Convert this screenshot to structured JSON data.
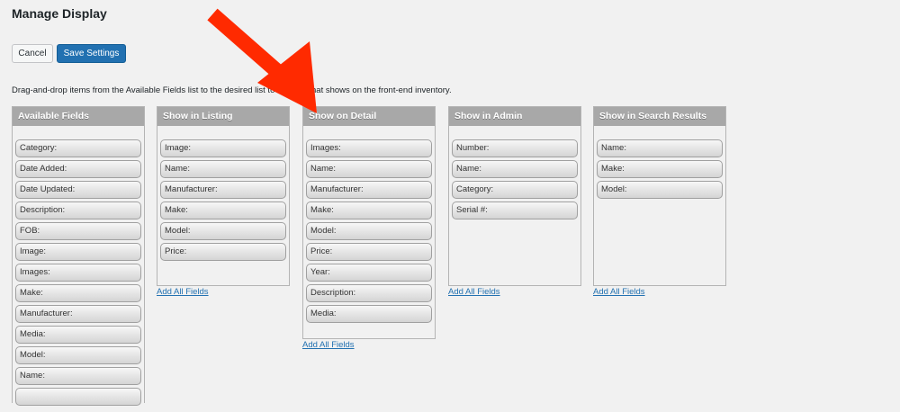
{
  "page": {
    "title": "Manage Display",
    "cancel_label": "Cancel",
    "save_label": "Save Settings",
    "instructions": "Drag-and-drop items from the Available Fields list to the desired list to control what shows on the front-end inventory."
  },
  "columns": [
    {
      "heading": "Available Fields",
      "items": [
        "Category:",
        "Date Added:",
        "Date Updated:",
        "Description:",
        "FOB:",
        "Image:",
        "Images:",
        "Make:",
        "Manufacturer:",
        "Media:",
        "Model:",
        "Name:"
      ]
    },
    {
      "heading": "Show in Listing",
      "items": [
        "Image:",
        "Name:",
        "Manufacturer:",
        "Make:",
        "Model:",
        "Price:"
      ],
      "add_all": "Add All Fields"
    },
    {
      "heading": "Show on Detail",
      "items": [
        "Images:",
        "Name:",
        "Manufacturer:",
        "Make:",
        "Model:",
        "Price:",
        "Year:",
        "Description:",
        "Media:"
      ],
      "add_all": "Add All Fields"
    },
    {
      "heading": "Show in Admin",
      "items": [
        "Number:",
        "Name:",
        "Category:",
        "Serial #:"
      ],
      "add_all": "Add All Fields"
    },
    {
      "heading": "Show in Search Results",
      "items": [
        "Name:",
        "Make:",
        "Model:"
      ],
      "add_all": "Add All Fields"
    }
  ],
  "colors": {
    "primary": "#2271b1",
    "header": "#a8a8a8",
    "arrow": "#ff2a00"
  }
}
